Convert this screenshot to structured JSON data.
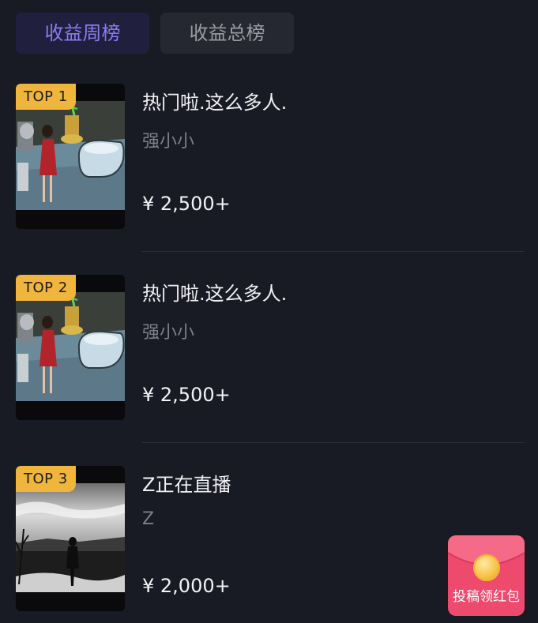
{
  "tabs": [
    {
      "label": "收益周榜",
      "active": true
    },
    {
      "label": "收益总榜",
      "active": false
    }
  ],
  "items": [
    {
      "rank": "TOP 1",
      "title": "热门啦.这么多人.",
      "author": "强小小",
      "earnings": "¥ 2,500+",
      "thumb": "bathroom-scene"
    },
    {
      "rank": "TOP 2",
      "title": "热门啦.这么多人.",
      "author": "强小小",
      "earnings": "¥ 2,500+",
      "thumb": "bathroom-scene"
    },
    {
      "rank": "TOP 3",
      "title": "Z正在直播",
      "author": "Z",
      "earnings": "¥ 2,000+",
      "thumb": "silhouette-landscape"
    }
  ],
  "red_packet": {
    "label": "投稿领红包",
    "icon": "red-envelope-icon"
  },
  "colors": {
    "background": "#181a24",
    "tab_active_text": "#8c7bf0",
    "tab_active_bg": "#211f3e",
    "badge": "#efb53c",
    "red_packet": "#ee4a6e"
  }
}
